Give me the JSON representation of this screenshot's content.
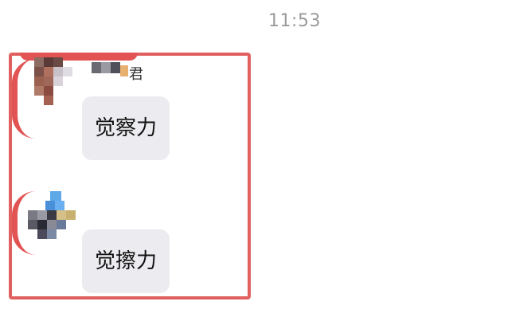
{
  "chat": {
    "timestamp": "11:53",
    "messages": [
      {
        "sender_visible_text": "君",
        "text": "觉察力"
      },
      {
        "sender_visible_text": "",
        "text": "觉擦力"
      }
    ]
  },
  "colors": {
    "highlight_border": "#e06060",
    "bubble_background": "#ececf0",
    "timestamp_text": "#9a9a9a"
  }
}
